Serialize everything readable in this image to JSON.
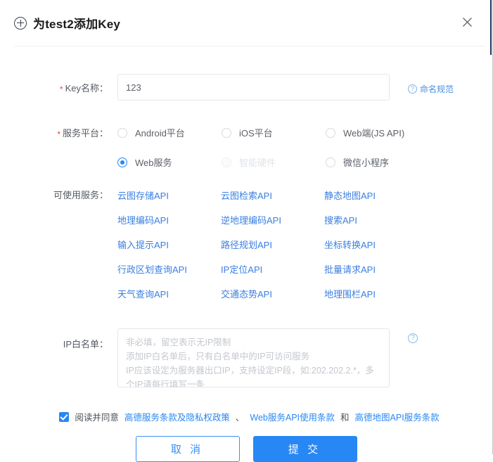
{
  "header": {
    "title": "为test2添加Key",
    "plus_icon": "plus-circle-icon",
    "close_icon": "close-icon"
  },
  "form": {
    "key_name": {
      "label": "Key名称：",
      "required_mark": "*",
      "value": "123",
      "placeholder": "",
      "hint_link": "命名规范",
      "hint_icon": "question-circle-icon"
    },
    "platform": {
      "label": "服务平台：",
      "required_mark": "*",
      "options": [
        {
          "label": "Android平台",
          "checked": false,
          "disabled": false
        },
        {
          "label": "iOS平台",
          "checked": false,
          "disabled": false
        },
        {
          "label": "Web端(JS API)",
          "checked": false,
          "disabled": false
        },
        {
          "label": "Web服务",
          "checked": true,
          "disabled": false
        },
        {
          "label": "智能硬件",
          "checked": false,
          "disabled": true
        },
        {
          "label": "微信小程序",
          "checked": false,
          "disabled": false
        }
      ]
    },
    "services": {
      "label": "可使用服务：",
      "items": [
        "云图存储API",
        "云图检索API",
        "静态地图API",
        "地理编码API",
        "逆地理编码API",
        "搜索API",
        "输入提示API",
        "路径规划API",
        "坐标转换API",
        "行政区划查询API",
        "IP定位API",
        "批量请求API",
        "天气查询API",
        "交通态势API",
        "地理围栏API"
      ]
    },
    "ip_whitelist": {
      "label": "IP白名单：",
      "value": "",
      "placeholder": "非必填，留空表示无IP限制\n添加IP白名单后，只有白名单中的IP可访问服务\nIP应该设定为服务器出口IP，支持设定IP段，如:202.202.2.*，多个IP请每行填写一条",
      "help_icon": "question-circle-icon"
    }
  },
  "agreement": {
    "checked": true,
    "prefix": "阅读并同意",
    "link1": "高德服务条款及隐私权政策",
    "sep1": "、",
    "link2": "Web服务API使用条款",
    "sep2": "和",
    "link3": "高德地图API服务条款"
  },
  "actions": {
    "cancel_label": "取 消",
    "submit_label": "提 交"
  },
  "colors": {
    "accent": "#2787f5",
    "link": "#3a7fe0",
    "required": "#d94b3c",
    "border": "#e3e6ea"
  }
}
